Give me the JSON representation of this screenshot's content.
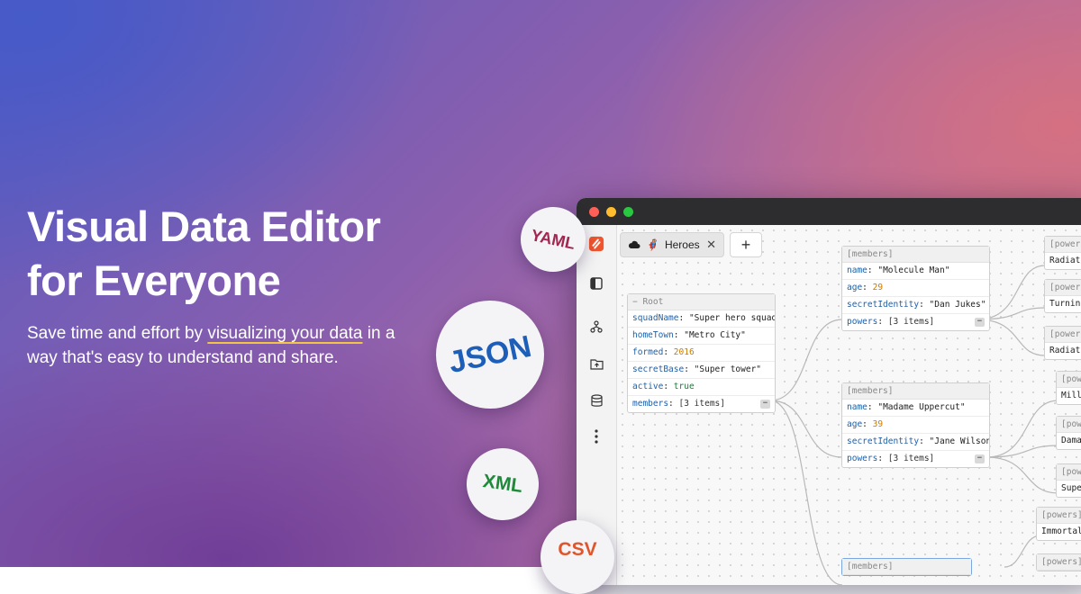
{
  "hero": {
    "headline_line1": "Visual Data Editor",
    "headline_line2": "for Everyone",
    "subtitle_pre": "Save time and effort by ",
    "subtitle_highlight": "visualizing your data",
    "subtitle_post": " in a way that's easy to understand and share."
  },
  "badges": {
    "yaml": "YAML",
    "json": "JSON",
    "xml": "XML",
    "csv": "CSV"
  },
  "app": {
    "tab": {
      "emoji": "🦸",
      "label": "Heroes",
      "close": "✕"
    },
    "add_tab": "+",
    "sidebar_icons": [
      "logo-icon",
      "panel-icon",
      "graph-icon",
      "folder-upload-icon",
      "database-icon",
      "more-icon"
    ]
  },
  "graph": {
    "root": {
      "header": "− Root",
      "rows": [
        {
          "key": "squadName",
          "value": "\"Super hero squad\""
        },
        {
          "key": "homeTown",
          "value": "\"Metro City\""
        },
        {
          "key": "formed",
          "value": "2016"
        },
        {
          "key": "secretBase",
          "value": "\"Super tower\""
        },
        {
          "key": "active",
          "value": "true"
        },
        {
          "key": "members",
          "value": "[3 items]"
        }
      ]
    },
    "member1": {
      "header": "[members]",
      "rows": [
        {
          "key": "name",
          "value": "\"Molecule Man\""
        },
        {
          "key": "age",
          "value": "29"
        },
        {
          "key": "secretIdentity",
          "value": "\"Dan Jukes\""
        },
        {
          "key": "powers",
          "value": "[3 items]"
        }
      ]
    },
    "member2": {
      "header": "[members]",
      "rows": [
        {
          "key": "name",
          "value": "\"Madame Uppercut\""
        },
        {
          "key": "age",
          "value": "39"
        },
        {
          "key": "secretIdentity",
          "value": "\"Jane Wilson\""
        },
        {
          "key": "powers",
          "value": "[3 items]"
        }
      ]
    },
    "member3": {
      "header": "[members]"
    },
    "powers": [
      {
        "header": "[powers]",
        "value": "Radiat"
      },
      {
        "header": "[powers]",
        "value": "Turnin"
      },
      {
        "header": "[powers]",
        "value": "Radiat"
      },
      {
        "header": "[powe",
        "value": "Milli"
      },
      {
        "header": "[powe",
        "value": "Damag"
      },
      {
        "header": "[powe",
        "value": "Super"
      },
      {
        "header": "[powers]",
        "value": "Immortal"
      },
      {
        "header": "[powers]",
        "value": ""
      }
    ],
    "collapse_symbol": "−"
  }
}
